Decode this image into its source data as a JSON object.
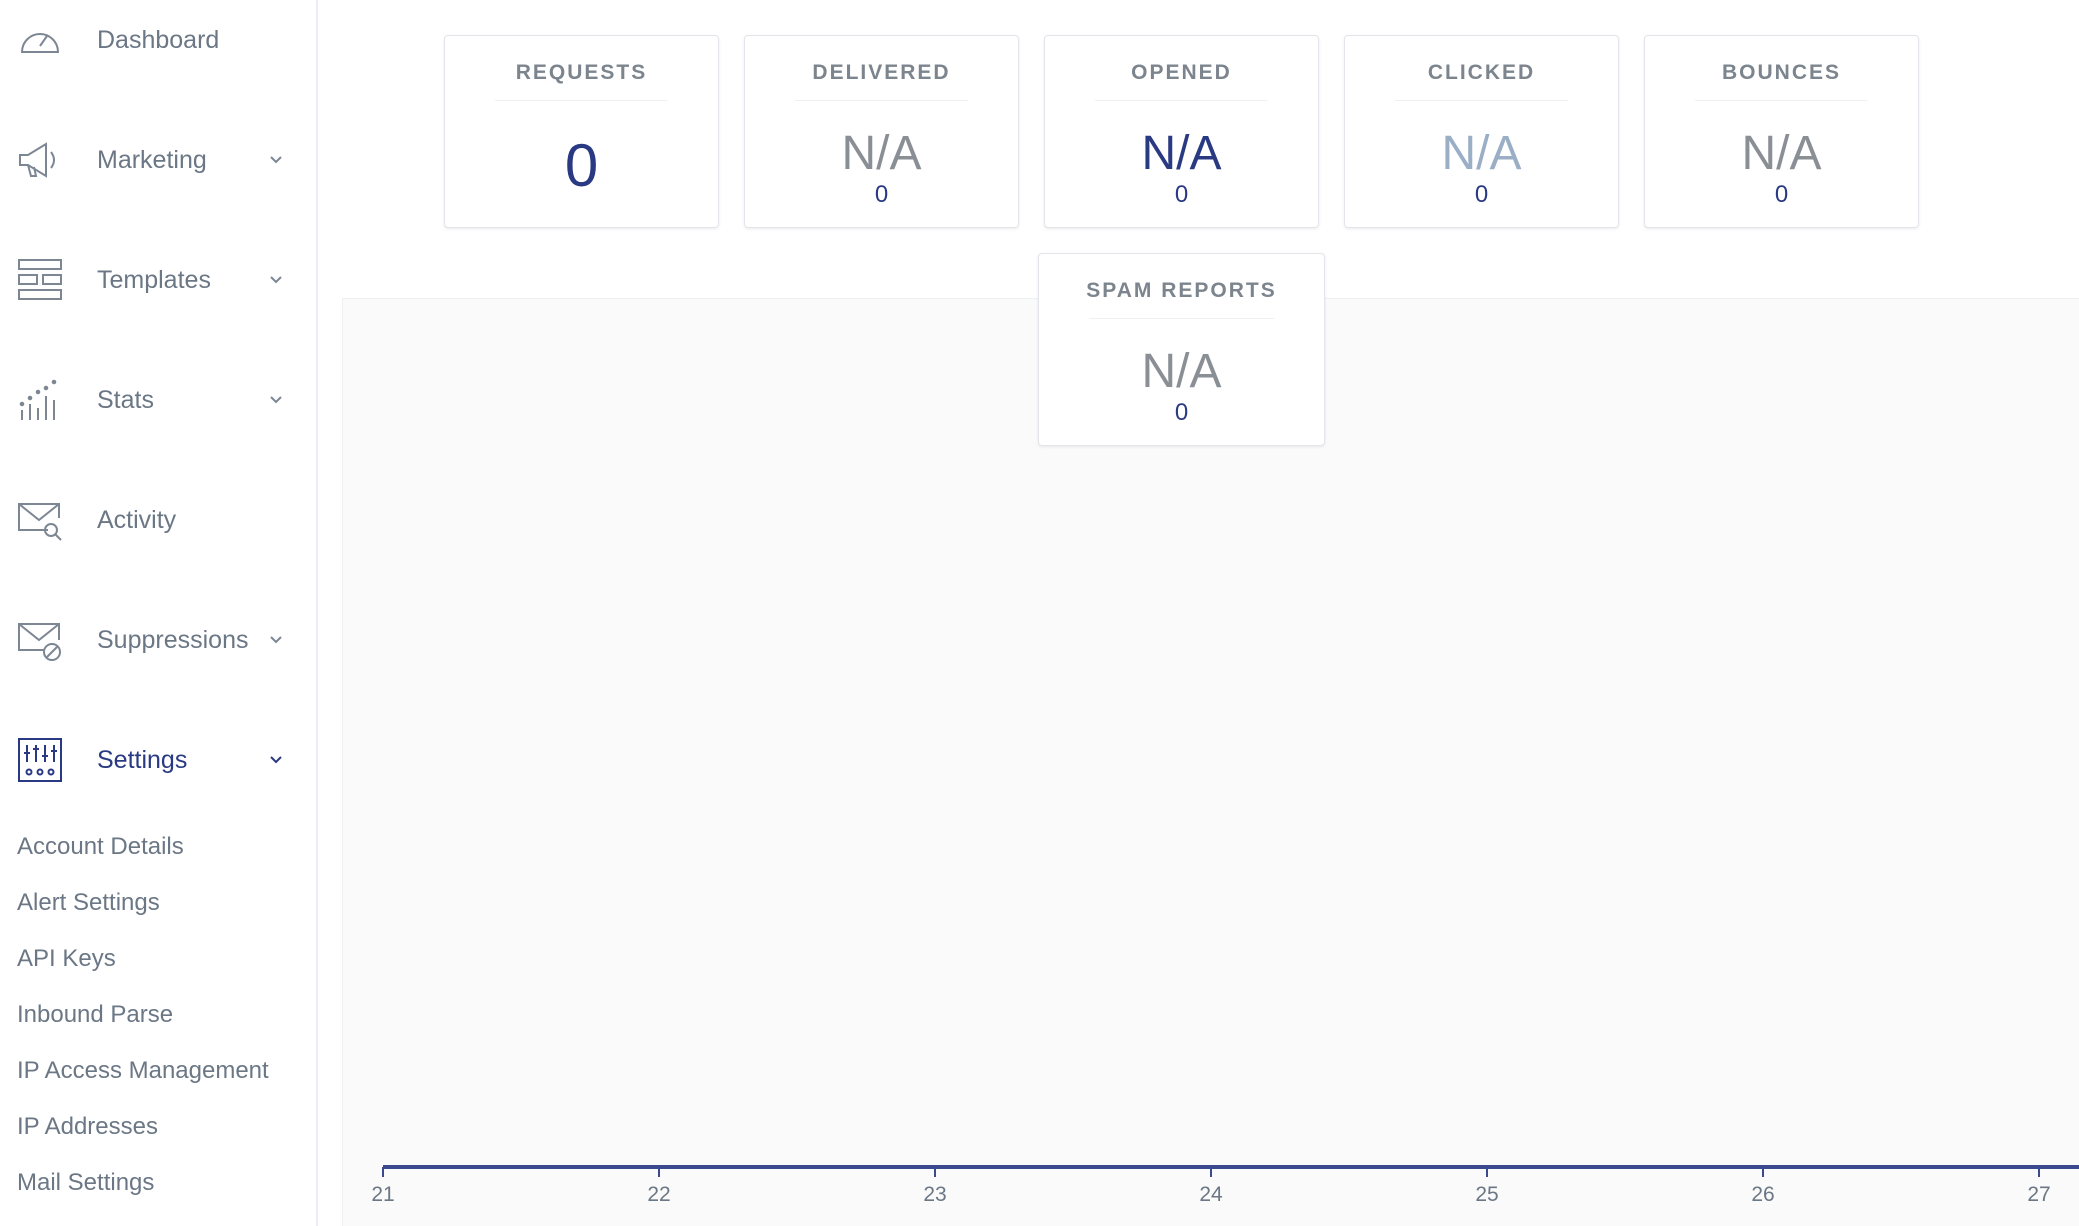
{
  "colors": {
    "accent": "#2a3a82",
    "muted_text": "#6b7785",
    "axis_line": "#3b4a8e",
    "light_blue": "#9aaec6",
    "gray_value": "#8a8f95"
  },
  "sidebar": {
    "items": [
      {
        "label": "Dashboard",
        "icon": "speedometer-icon",
        "has_chevron": false
      },
      {
        "label": "Marketing",
        "icon": "megaphone-icon",
        "has_chevron": true
      },
      {
        "label": "Templates",
        "icon": "templates-icon",
        "has_chevron": true
      },
      {
        "label": "Stats",
        "icon": "bar-chart-icon",
        "has_chevron": true
      },
      {
        "label": "Activity",
        "icon": "envelope-search-icon",
        "has_chevron": false
      },
      {
        "label": "Suppressions",
        "icon": "envelope-block-icon",
        "has_chevron": true
      },
      {
        "label": "Settings",
        "icon": "sliders-icon",
        "has_chevron": true,
        "active": true
      }
    ],
    "settings_subitems": [
      "Account Details",
      "Alert Settings",
      "API Keys",
      "Inbound Parse",
      "IP Access Management",
      "IP Addresses",
      "Mail Settings"
    ]
  },
  "stats": {
    "requests": {
      "title": "REQUESTS",
      "value": "0"
    },
    "delivered": {
      "title": "DELIVERED",
      "value": "N/A",
      "count": "0"
    },
    "opened": {
      "title": "OPENED",
      "value": "N/A",
      "count": "0"
    },
    "clicked": {
      "title": "CLICKED",
      "value": "N/A",
      "count": "0"
    },
    "bounces": {
      "title": "BOUNCES",
      "value": "N/A",
      "count": "0"
    },
    "spam_reports": {
      "title": "SPAM REPORTS",
      "value": "N/A",
      "count": "0"
    }
  },
  "chart_data": {
    "type": "line",
    "x": [
      "21",
      "22",
      "23",
      "24",
      "25",
      "26",
      "27"
    ],
    "series": [
      {
        "values": [
          0,
          0,
          0,
          0,
          0,
          0,
          0
        ]
      }
    ],
    "title": "",
    "xlabel": "",
    "ylabel": "",
    "grid": false
  }
}
